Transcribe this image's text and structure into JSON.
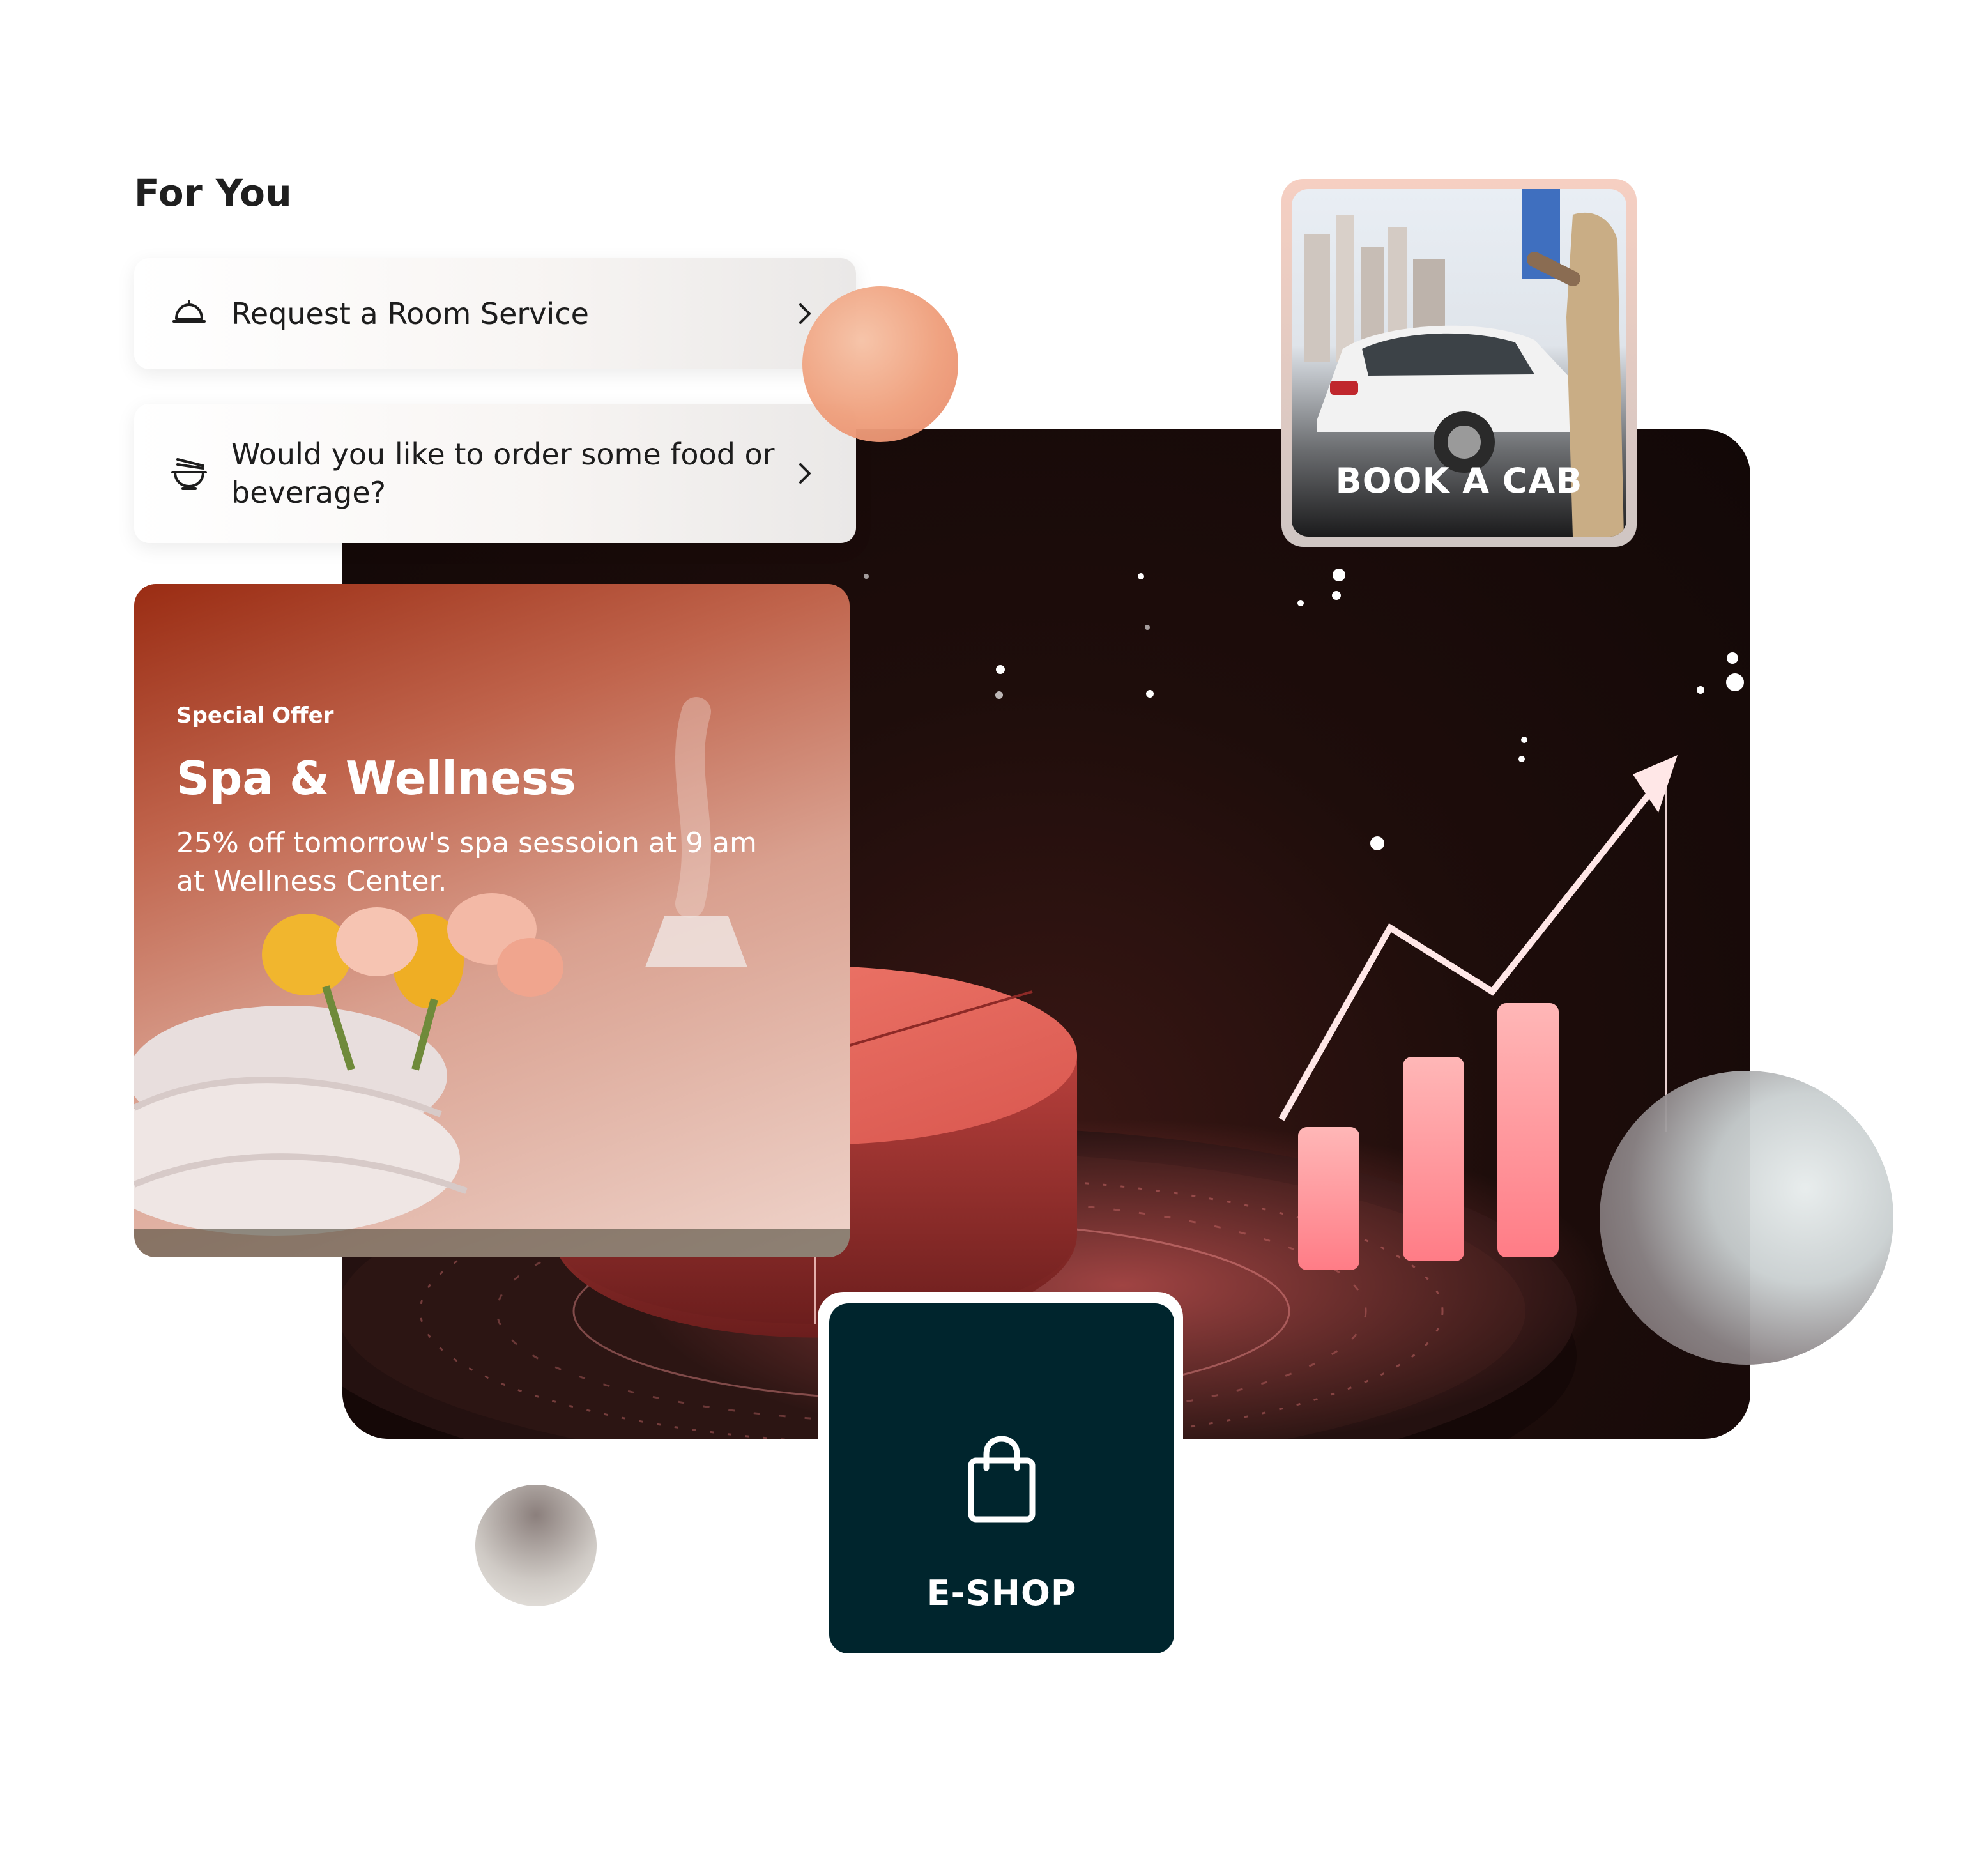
{
  "section": {
    "title": "For You"
  },
  "quick_actions": [
    {
      "label": "Request a Room Service",
      "icon": "room-service-cloche-icon"
    },
    {
      "label": "Would you like to order some food or beverage?",
      "icon": "food-bowl-icon"
    }
  ],
  "promo": {
    "badge": "Special Offer",
    "title": "Spa & Wellness",
    "description": "25% off tomorrow's spa sessoion at 9 am at Wellness Center."
  },
  "cab": {
    "label": "BOOK A CAB"
  },
  "eshop": {
    "label": "E-SHOP",
    "icon": "shopping-bag-icon"
  },
  "colors": {
    "accent_peach": "#ef9f7c",
    "stage_dark": "#1e0d0b",
    "eshop_bg": "#00252d",
    "promo_start": "#9a2c13"
  }
}
